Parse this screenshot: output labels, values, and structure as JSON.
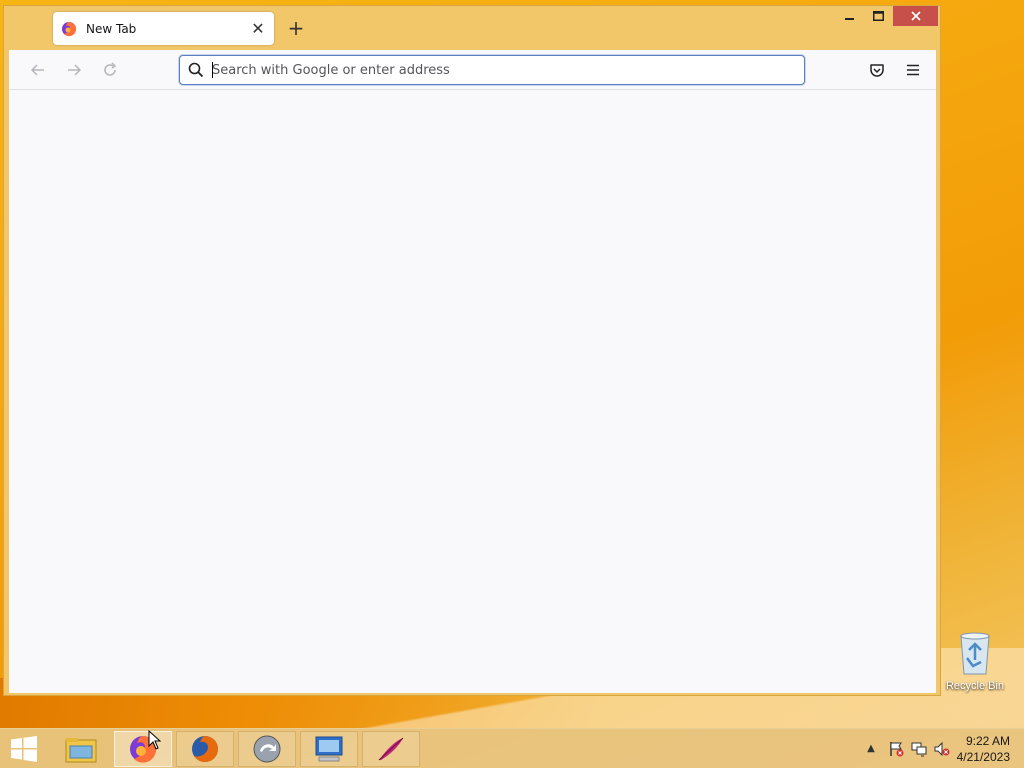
{
  "browser": {
    "tab": {
      "title": "New Tab"
    },
    "urlbar": {
      "placeholder": "Search with Google or enter address",
      "value": ""
    },
    "window_controls": {
      "minimize": "‒",
      "maximize": "□",
      "close": "✕"
    },
    "icons": {
      "back": "arrow-left-icon",
      "forward": "arrow-right-icon",
      "reload": "reload-icon",
      "search": "search-icon",
      "pocket": "pocket-icon",
      "menu": "hamburger-menu-icon"
    }
  },
  "desktop": {
    "recycle_bin": {
      "label": "Recycle Bin"
    }
  },
  "taskbar": {
    "items": [
      "file-explorer-icon",
      "firefox-icon",
      "firefox-legacy-icon",
      "update-icon",
      "remote-desktop-icon",
      "feather-app-icon"
    ],
    "clock": {
      "time": "9:22 AM",
      "date": "4/21/2023"
    }
  },
  "colors": {
    "accent": "#5b7fc0",
    "close_button": "#c7504a",
    "titlebar": "#f2c76a",
    "content_bg": "#f9f9fb"
  }
}
